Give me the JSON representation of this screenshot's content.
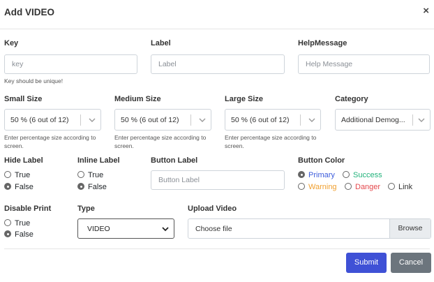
{
  "modal": {
    "title": "Add VIDEO",
    "close_glyph": "×"
  },
  "key": {
    "label": "Key",
    "placeholder": "key",
    "hint": "Key should be unique!"
  },
  "label_field": {
    "label": "Label",
    "placeholder": "Label"
  },
  "help": {
    "label": "HelpMessage",
    "placeholder": "Help Message"
  },
  "small_size": {
    "label": "Small Size",
    "value": "50 % (6 out of 12)",
    "hint": "Enter percentage size according to screen."
  },
  "medium_size": {
    "label": "Medium Size",
    "value": "50 % (6 out of 12)",
    "hint": "Enter percentage size according to screen."
  },
  "large_size": {
    "label": "Large Size",
    "value": "50 % (6 out of 12)",
    "hint": "Enter percentage size according to screen."
  },
  "category": {
    "label": "Category",
    "value": "Additional Demog..."
  },
  "hide_label": {
    "label": "Hide Label",
    "options": [
      "True",
      "False"
    ],
    "selected": "False"
  },
  "inline_label": {
    "label": "Inline Label",
    "options": [
      "True",
      "False"
    ],
    "selected": "False"
  },
  "button_label": {
    "label": "Button Label",
    "placeholder": "Button Label"
  },
  "button_color": {
    "label": "Button Color",
    "options": [
      {
        "text": "Primary",
        "color": "#3b5bdb"
      },
      {
        "text": "Success",
        "color": "#20b27a"
      },
      {
        "text": "Warning",
        "color": "#f0a030"
      },
      {
        "text": "Danger",
        "color": "#e5484d"
      },
      {
        "text": "Link",
        "color": "#333333"
      }
    ],
    "selected": "Primary"
  },
  "disable_print": {
    "label": "Disable Print",
    "options": [
      "True",
      "False"
    ],
    "selected": "False"
  },
  "type": {
    "label": "Type",
    "value": "VIDEO"
  },
  "upload": {
    "label": "Upload Video",
    "placeholder": "Choose file",
    "browse": "Browse"
  },
  "actions": {
    "submit": "Submit",
    "cancel": "Cancel",
    "submit_color": "#3f51d6",
    "cancel_color": "#6c757d"
  }
}
